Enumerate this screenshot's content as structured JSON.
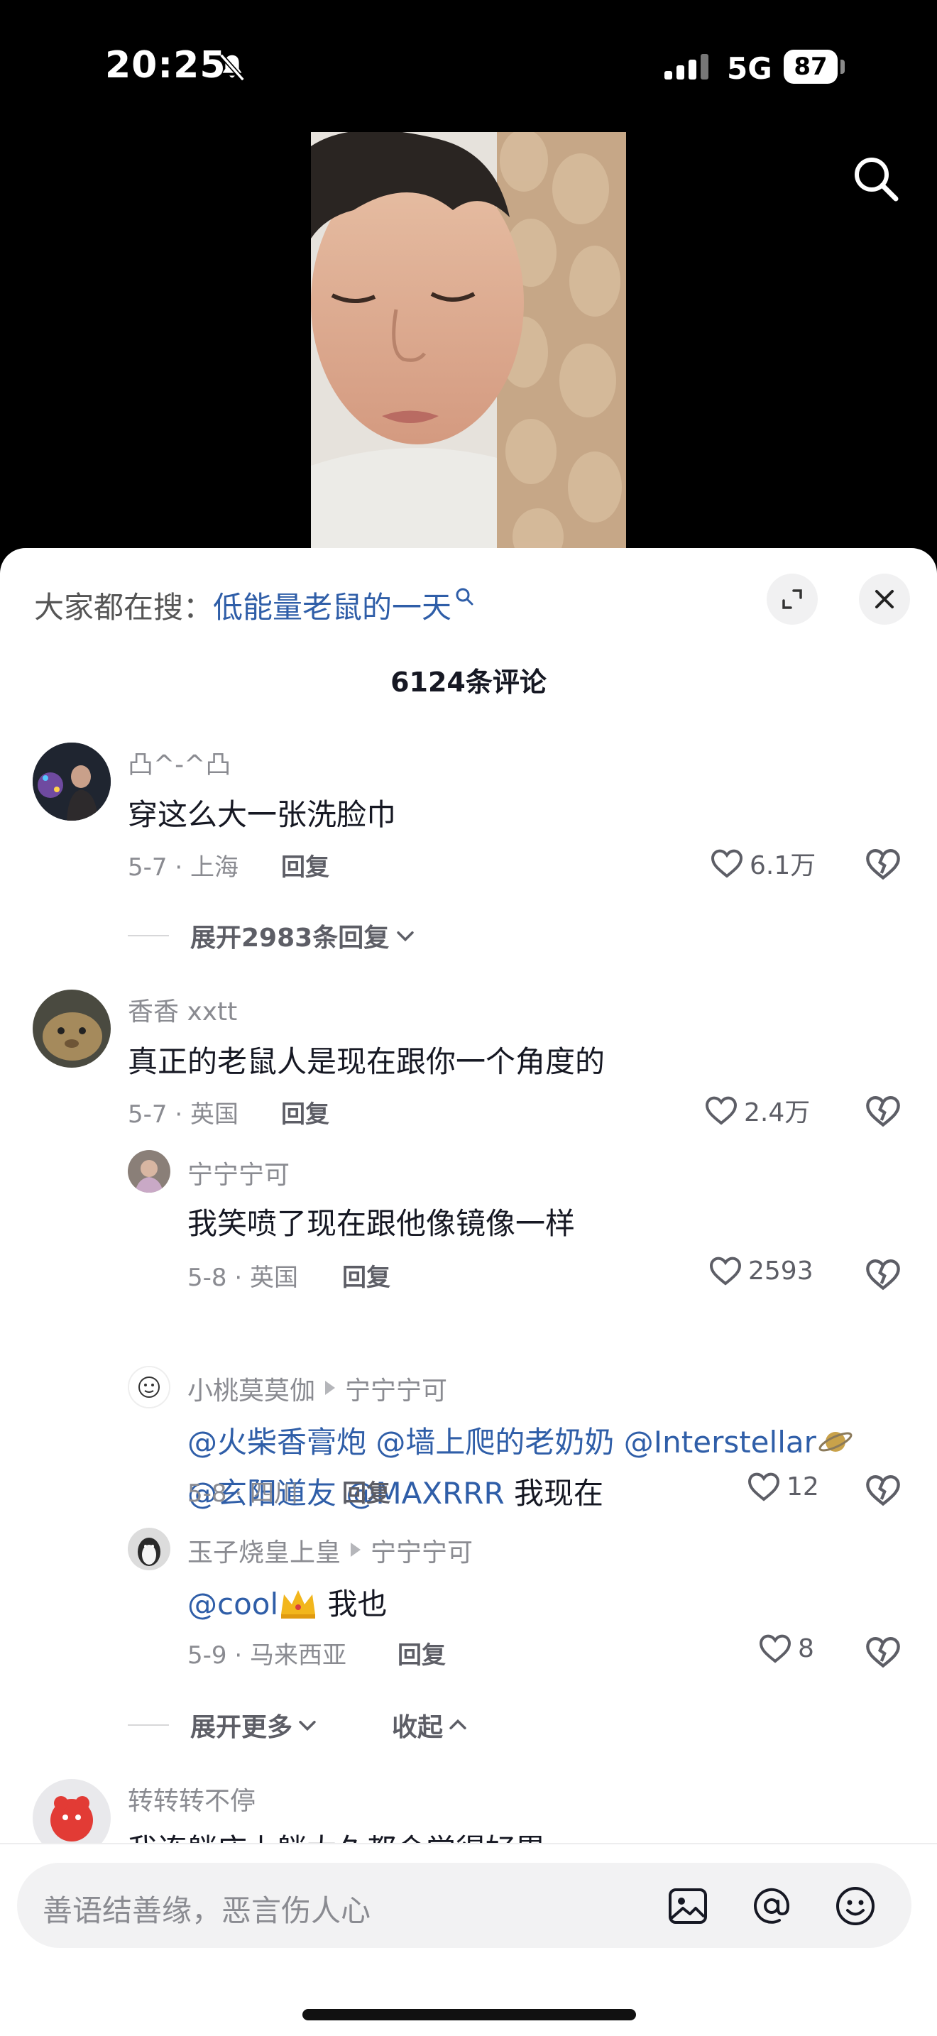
{
  "status_bar": {
    "time": "20:25",
    "network": "5G",
    "battery": "87"
  },
  "sheet": {
    "hot_search_prefix": "大家都在搜：",
    "hot_search_term": "低能量老鼠的一天",
    "comment_count_title": "6124条评论"
  },
  "comments": [
    {
      "username": "凸^-^凸",
      "text": "穿这么大一张洗脸巾",
      "meta": "5-7 · 上海",
      "reply_label": "回复",
      "likes": "6.1万",
      "expand_label": "展开2983条回复"
    },
    {
      "username": "香香 xxtt",
      "text": "真正的老鼠人是现在跟你一个角度的",
      "meta": "5-7 · 英国",
      "reply_label": "回复",
      "likes": "2.4万",
      "replies": [
        {
          "username": "宁宁宁可",
          "text": "我笑喷了现在跟他像镜像一样",
          "meta": "5-8 · 英国",
          "reply_label": "回复",
          "likes": "2593"
        },
        {
          "username": "小桃莫莫伽",
          "reply_to": "宁宁宁可",
          "mentions_line1": [
            "@火柴香膏炮",
            "@墙上爬的老奶奶",
            "@Interstellar"
          ],
          "mentions_line2": [
            "@玄阳道友",
            "@MAXRRR"
          ],
          "text_tail": "我现在",
          "meta": "5-8 · 四川",
          "reply_label": "回复",
          "likes": "12"
        },
        {
          "username": "玉子烧皇上皇",
          "reply_to": "宁宁宁可",
          "mention": "@cool",
          "text_tail": "我也",
          "meta": "5-9 · 马来西亚",
          "reply_label": "回复",
          "likes": "8"
        }
      ],
      "expand_more_label": "展开更多",
      "collapse_label": "收起"
    },
    {
      "username": "转转转不停",
      "text": "我连躺床上躺太久都会觉得好累"
    }
  ],
  "input": {
    "placeholder": "善语结善缘，恶言伤人心"
  },
  "icons": [
    "mute-bell-icon",
    "signal-icon",
    "search-icon",
    "expand-icon",
    "close-icon",
    "heart-icon",
    "broken-heart-icon",
    "chevron-down-icon",
    "chevron-up-icon",
    "image-icon",
    "at-icon",
    "emoji-icon",
    "crown-emoji-icon",
    "planet-emoji-icon"
  ],
  "colors": {
    "link_blue": "#2f5ea8",
    "text_primary": "#161823",
    "text_secondary": "#8a8b91"
  }
}
